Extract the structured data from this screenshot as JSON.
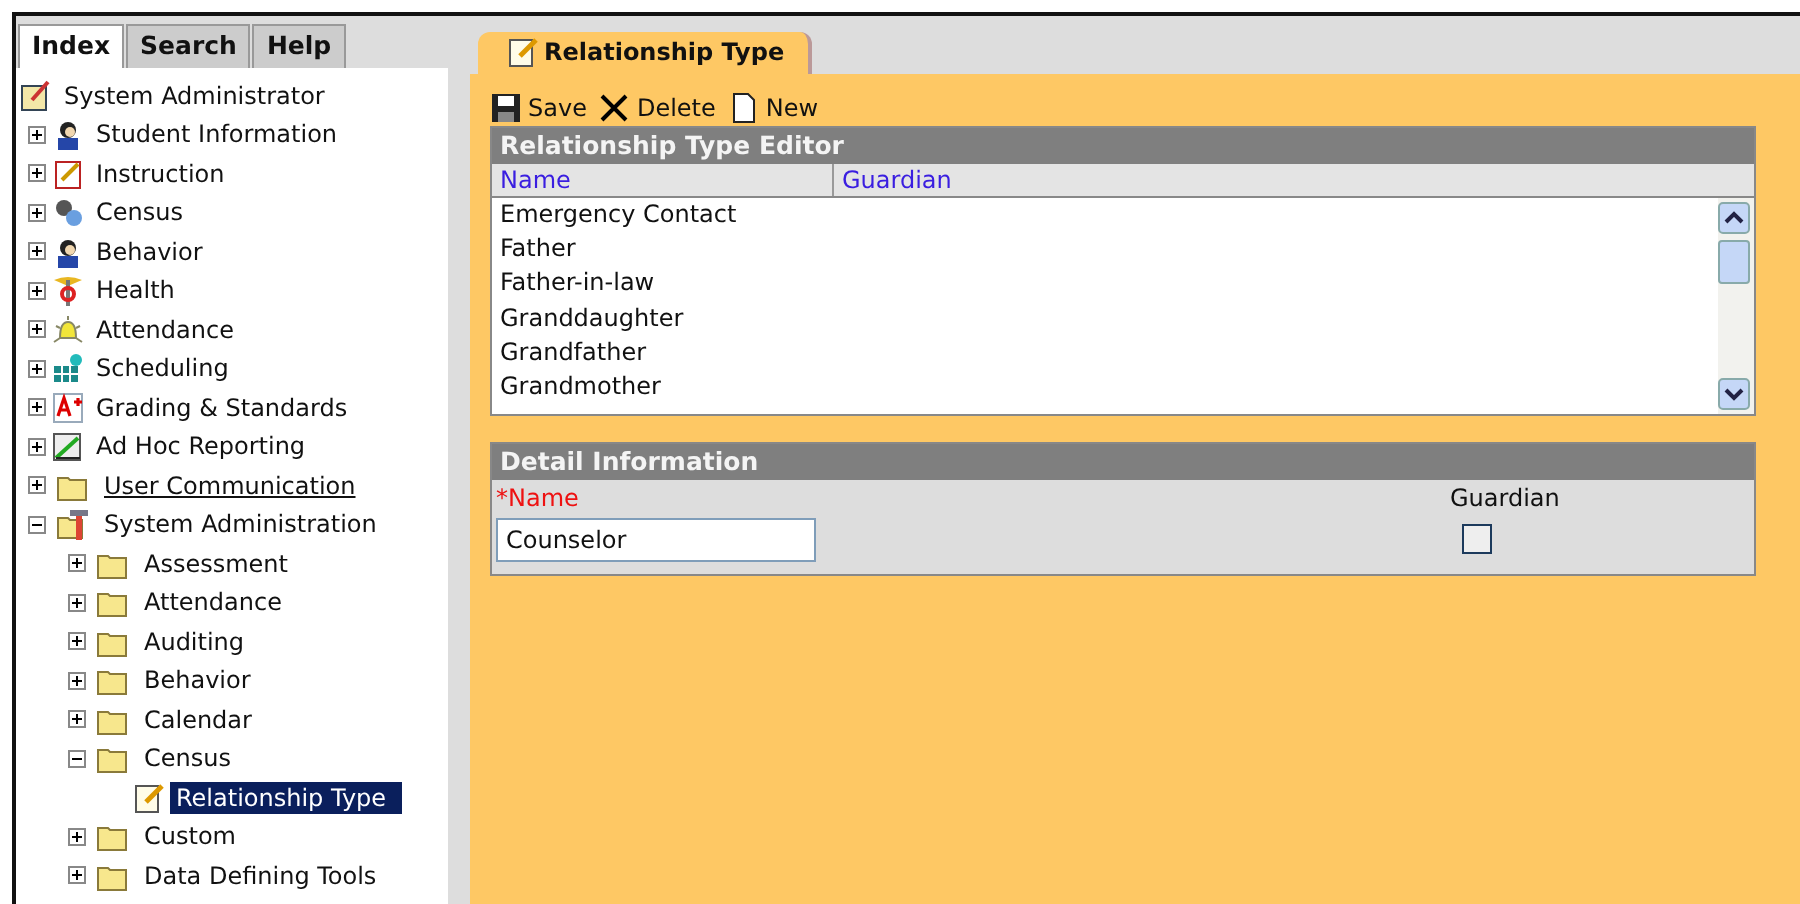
{
  "nav_tabs": [
    {
      "label": "Index",
      "selected": true
    },
    {
      "label": "Search",
      "selected": false
    },
    {
      "label": "Help",
      "selected": false
    }
  ],
  "tree": {
    "root": {
      "label": "System Administrator",
      "kind": "admin"
    },
    "items": [
      {
        "label": "Student Information",
        "kind": "person",
        "expanded": false,
        "selected": false,
        "hovered": false
      },
      {
        "label": "Instruction",
        "kind": "notebook",
        "expanded": false,
        "selected": false,
        "hovered": false
      },
      {
        "label": "Census",
        "kind": "people",
        "expanded": false,
        "selected": false,
        "hovered": false
      },
      {
        "label": "Behavior",
        "kind": "person",
        "expanded": false,
        "selected": false,
        "hovered": false
      },
      {
        "label": "Health",
        "kind": "health",
        "expanded": false,
        "selected": false,
        "hovered": false
      },
      {
        "label": "Attendance",
        "kind": "bell",
        "expanded": false,
        "selected": false,
        "hovered": false
      },
      {
        "label": "Scheduling",
        "kind": "blocks",
        "expanded": false,
        "selected": false,
        "hovered": false
      },
      {
        "label": "Grading & Standards",
        "kind": "grade",
        "expanded": false,
        "selected": false,
        "hovered": false
      },
      {
        "label": "Ad Hoc Reporting",
        "kind": "chart",
        "expanded": false,
        "selected": false,
        "hovered": false
      },
      {
        "label": "User Communication",
        "kind": "folder",
        "expanded": false,
        "selected": false,
        "hovered": true
      },
      {
        "label": "System Administration",
        "kind": "tools",
        "expanded": true,
        "selected": false,
        "hovered": false,
        "children": [
          {
            "label": "Assessment",
            "kind": "folder",
            "expanded": false,
            "selected": false,
            "hovered": false
          },
          {
            "label": "Attendance",
            "kind": "folder",
            "expanded": false,
            "selected": false,
            "hovered": false
          },
          {
            "label": "Auditing",
            "kind": "folder",
            "expanded": false,
            "selected": false,
            "hovered": false
          },
          {
            "label": "Behavior",
            "kind": "folder",
            "expanded": false,
            "selected": false,
            "hovered": false
          },
          {
            "label": "Calendar",
            "kind": "folder",
            "expanded": false,
            "selected": false,
            "hovered": false
          },
          {
            "label": "Census",
            "kind": "folder",
            "expanded": true,
            "selected": false,
            "hovered": false,
            "children": [
              {
                "label": "Relationship Type",
                "kind": "page",
                "selected": true,
                "hovered": false
              }
            ]
          },
          {
            "label": "Custom",
            "kind": "folder",
            "expanded": false,
            "selected": false,
            "hovered": false
          },
          {
            "label": "Data Defining Tools",
            "kind": "folder",
            "expanded": false,
            "selected": false,
            "hovered": false
          }
        ]
      }
    ]
  },
  "page_tab": {
    "label": "Relationship Type"
  },
  "toolbar": [
    {
      "label": "Save",
      "kind": "save"
    },
    {
      "label": "Delete",
      "kind": "delete"
    },
    {
      "label": "New",
      "kind": "new"
    }
  ],
  "editor": {
    "title": "Relationship Type Editor",
    "columns": [
      "Name",
      "Guardian"
    ],
    "rows": [
      "Emergency Contact",
      "Father",
      "Father-in-law",
      "Granddaughter",
      "Grandfather",
      "Grandmother"
    ]
  },
  "detail": {
    "title": "Detail Information",
    "name_label": "*Name",
    "name_value": "Counselor",
    "guardian_label": "Guardian",
    "guardian_checked": false
  }
}
